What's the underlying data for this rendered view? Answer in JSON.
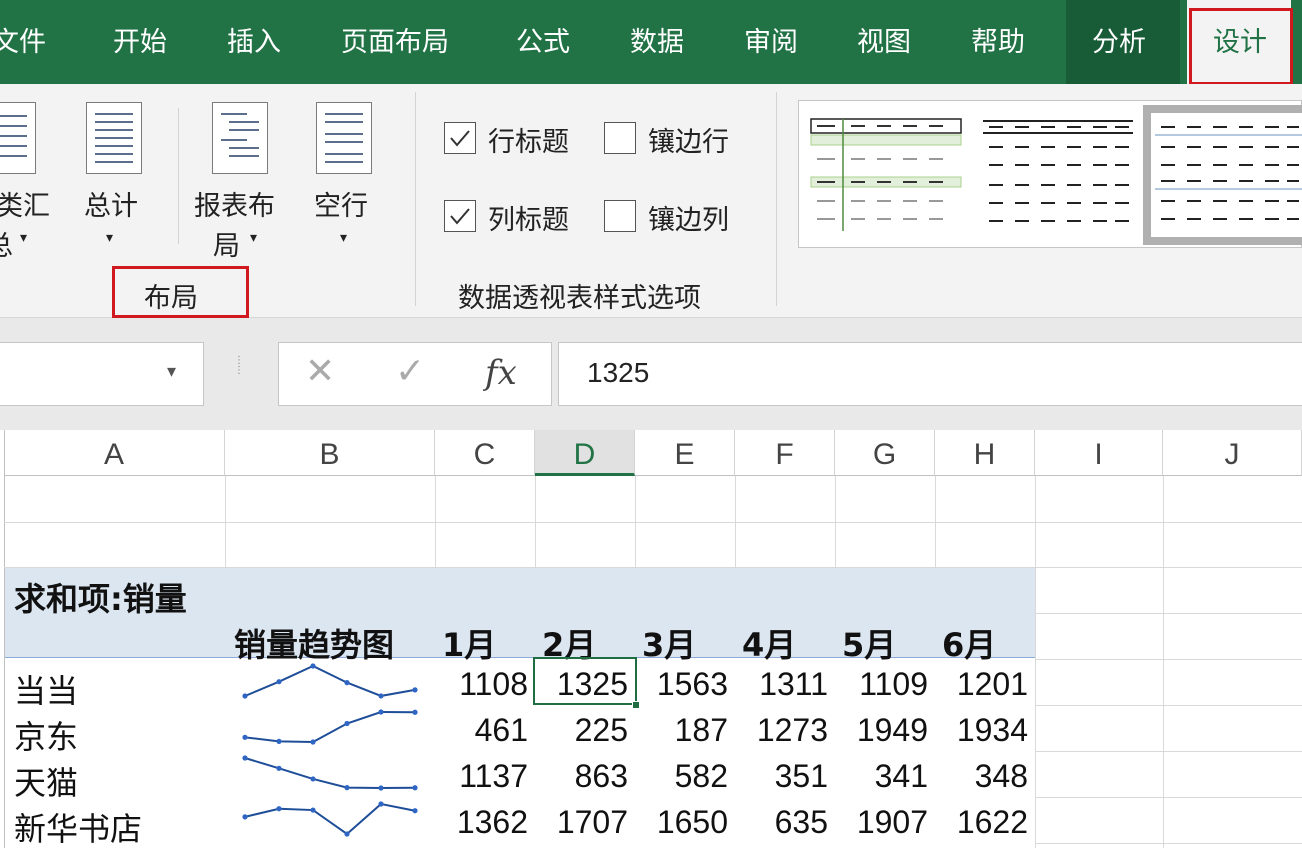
{
  "tabs": [
    {
      "label": "文件"
    },
    {
      "label": "开始"
    },
    {
      "label": "插入"
    },
    {
      "label": "页面布局"
    },
    {
      "label": "公式"
    },
    {
      "label": "数据"
    },
    {
      "label": "审阅"
    },
    {
      "label": "视图"
    },
    {
      "label": "帮助"
    },
    {
      "label": "分析"
    },
    {
      "label": "设计"
    }
  ],
  "ribbon": {
    "layout_group": {
      "subtotals_line1": "类汇",
      "subtotals_line2": "总",
      "grand_totals": "总计",
      "report_layout_line1": "报表布",
      "report_layout_line2": "局",
      "blank_rows": "空行",
      "group_label": "布局"
    },
    "style_options": {
      "row_headers": "行标题",
      "banded_rows": "镶边行",
      "column_headers": "列标题",
      "banded_columns": "镶边列",
      "row_headers_checked": true,
      "column_headers_checked": true,
      "banded_rows_checked": false,
      "banded_columns_checked": false,
      "group_label": "数据透视表样式选项"
    }
  },
  "formula_bar": {
    "value": "1325",
    "fx_label": "fx"
  },
  "sheet": {
    "columns": [
      "A",
      "B",
      "C",
      "D",
      "E",
      "F",
      "G",
      "H",
      "I",
      "J"
    ],
    "selected_column": "D",
    "pivot": {
      "title": "求和项:销量",
      "trend_header": "销量趋势图",
      "months": [
        "1月",
        "2月",
        "3月",
        "4月",
        "5月",
        "6月"
      ],
      "rows": [
        {
          "name": "当当",
          "values": [
            1108,
            1325,
            1563,
            1311,
            1109,
            1201
          ]
        },
        {
          "name": "京东",
          "values": [
            461,
            225,
            187,
            1273,
            1949,
            1934
          ]
        },
        {
          "name": "天猫",
          "values": [
            1137,
            863,
            582,
            351,
            341,
            348
          ]
        },
        {
          "name": "新华书店",
          "values": [
            1362,
            1707,
            1650,
            635,
            1907,
            1622
          ]
        }
      ]
    }
  }
}
